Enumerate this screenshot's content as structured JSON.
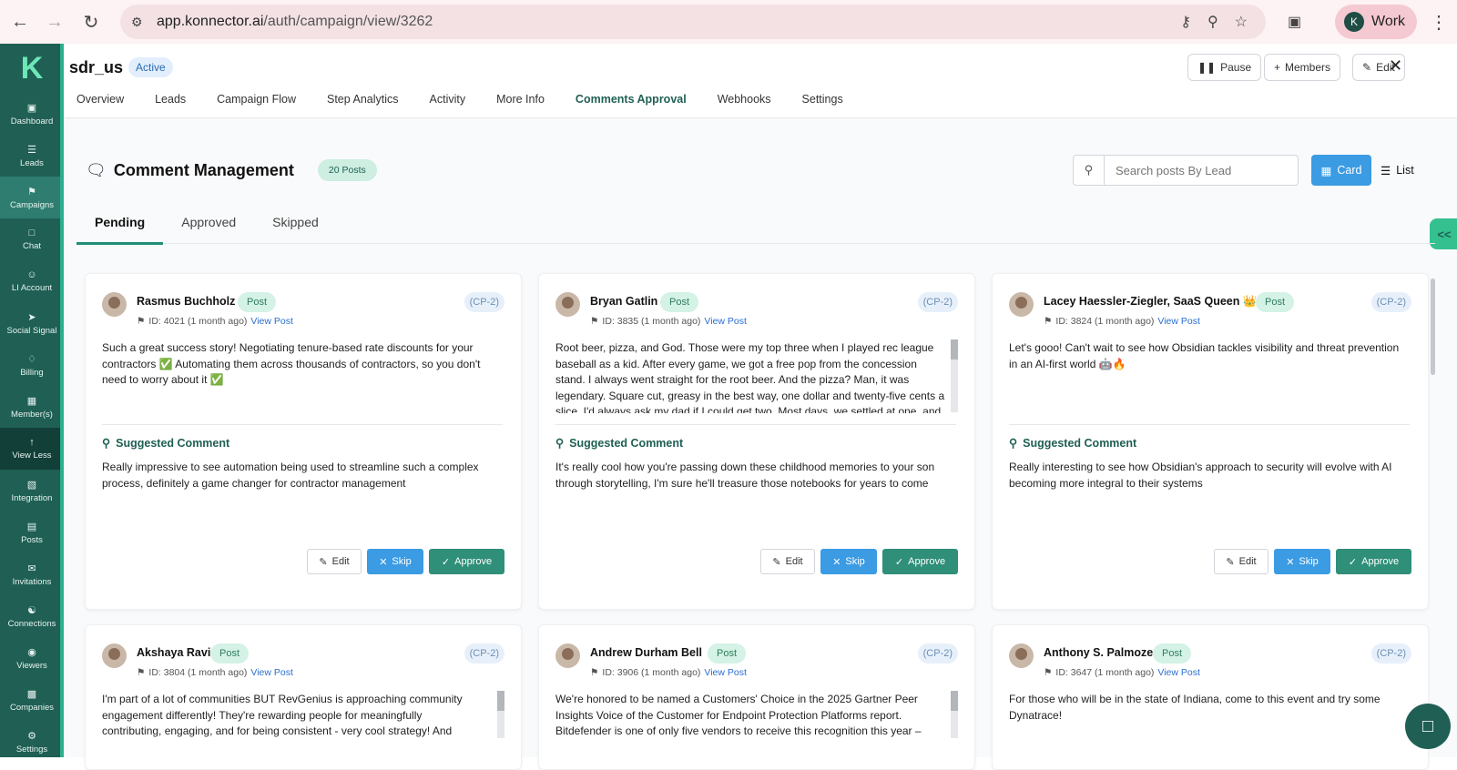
{
  "browser": {
    "url_domain": "app.konnector.ai",
    "url_path": "/auth/campaign/view/3262",
    "profile_initial": "K",
    "profile_label": "Work"
  },
  "sidebar": {
    "logo": "K",
    "items": [
      {
        "label": "Dashboard",
        "icon": "dashboard-icon"
      },
      {
        "label": "Leads",
        "icon": "leads-icon"
      },
      {
        "label": "Campaigns",
        "icon": "megaphone-icon"
      },
      {
        "label": "Chat",
        "icon": "chat-icon"
      },
      {
        "label": "LI Account",
        "icon": "account-icon"
      },
      {
        "label": "Social Signal",
        "icon": "share-icon"
      },
      {
        "label": "Billing",
        "icon": "tag-icon"
      },
      {
        "label": "Member(s)",
        "icon": "members-icon"
      },
      {
        "label": "View Less",
        "icon": "arrow-up-icon"
      },
      {
        "label": "Integration",
        "icon": "integration-icon"
      },
      {
        "label": "Posts",
        "icon": "posts-icon"
      },
      {
        "label": "Invitations",
        "icon": "invitations-icon"
      },
      {
        "label": "Connections",
        "icon": "connections-icon"
      },
      {
        "label": "Viewers",
        "icon": "viewers-icon"
      },
      {
        "label": "Companies",
        "icon": "companies-icon"
      },
      {
        "label": "Settings",
        "icon": "gear-icon"
      }
    ]
  },
  "header": {
    "campaign_name": "sdr_us",
    "status": "Active",
    "pause_label": "Pause",
    "members_label": "Members",
    "edit_label": "Edit",
    "tabs": [
      "Overview",
      "Leads",
      "Campaign Flow",
      "Step Analytics",
      "Activity",
      "More Info",
      "Comments Approval",
      "Webhooks",
      "Settings"
    ]
  },
  "comments": {
    "title": "Comment Management",
    "posts_count": "20 Posts",
    "search_placeholder": "Search posts By Lead",
    "card_view_label": "Card",
    "list_view_label": "List",
    "subtabs": [
      "Pending",
      "Approved",
      "Skipped"
    ],
    "suggested_label": "Suggested Comment",
    "edit_label": "Edit",
    "skip_label": "Skip",
    "approve_label": "Approve",
    "post_badge": "Post",
    "view_post": "View Post",
    "cards": [
      {
        "name": "Rasmus Buchholz",
        "campaign_tag": "(CP-2)",
        "meta": "ID: 4021 (1 month ago)",
        "post_text": "Such a great success story! Negotiating tenure-based rate discounts for your contractors ✅ Automating them across thousands of contractors, so you don't need to worry about it ✅",
        "suggested": "Really impressive to see automation being used to streamline such a complex process, definitely a game changer for contractor management"
      },
      {
        "name": "Bryan Gatlin",
        "campaign_tag": "(CP-2)",
        "meta": "ID: 3835 (1 month ago)",
        "post_text": "Root beer, pizza, and God. Those were my top three when I played rec league baseball as a kid. After every game, we got a free pop from the concession stand. I always went straight for the root beer. And the pizza? Man, it was legendary. Square cut, greasy in the best way, one dollar and twenty-five cents a slice. I'd always ask my dad if I could get two. Most days, we settled at one, and",
        "suggested": "It's really cool how you're passing down these childhood memories to your son through storytelling, I'm sure he'll treasure those notebooks for years to come"
      },
      {
        "name": "Lacey Haessler-Ziegler, SaaS Queen 👑",
        "campaign_tag": "(CP-2)",
        "meta": "ID: 3824 (1 month ago)",
        "post_text": "Let's gooo! Can't wait to see how Obsidian tackles visibility and threat prevention in an AI-first world 🤖🔥",
        "suggested": "Really interesting to see how Obsidian's approach to security will evolve with AI becoming more integral to their systems"
      },
      {
        "name": "Akshaya Ravi",
        "campaign_tag": "(CP-2)",
        "meta": "ID: 3804 (1 month ago)",
        "post_text": "I'm part of a lot of communities BUT RevGenius is approaching community engagement differently! They're rewarding people for meaningfully contributing, engaging, and for being consistent - very cool strategy! And",
        "suggested": ""
      },
      {
        "name": "Andrew Durham Bell",
        "campaign_tag": "(CP-2)",
        "meta": "ID: 3906 (1 month ago)",
        "post_text": "We're honored to be named a Customers' Choice in the 2025 Gartner Peer Insights Voice of the Customer for Endpoint Protection Platforms report. Bitdefender is one of only five vendors to receive this recognition this year –",
        "suggested": ""
      },
      {
        "name": "Anthony S. Palmoze",
        "campaign_tag": "(CP-2)",
        "meta": "ID: 3647 (1 month ago)",
        "post_text": "For those who will be in the state of Indiana, come to this event and try some Dynatrace!",
        "suggested": ""
      }
    ]
  }
}
